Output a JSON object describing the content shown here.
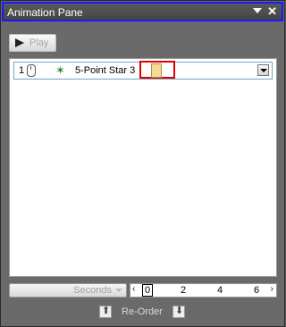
{
  "titlebar": {
    "title": "Animation Pane"
  },
  "toolbar": {
    "play_label": "Play"
  },
  "list": {
    "items": [
      {
        "number": "1",
        "name": "5-Point Star 3"
      }
    ]
  },
  "timeline": {
    "units_label": "Seconds",
    "left_nav": "‹",
    "right_nav": "›",
    "ticks": [
      "0",
      "2",
      "4",
      "6"
    ]
  },
  "reorder": {
    "label": "Re-Order"
  }
}
